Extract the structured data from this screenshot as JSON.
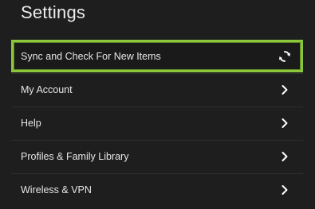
{
  "header": {
    "title": "Settings"
  },
  "menu": {
    "items": [
      {
        "label": "Sync and Check For New Items",
        "trailing_icon": "sync-icon",
        "highlighted": true
      },
      {
        "label": "My Account",
        "trailing_icon": "chevron-right-icon"
      },
      {
        "label": "Help",
        "trailing_icon": "chevron-right-icon"
      },
      {
        "label": "Profiles & Family Library",
        "trailing_icon": "chevron-right-icon"
      },
      {
        "label": "Wireless & VPN",
        "trailing_icon": "chevron-right-icon"
      }
    ]
  },
  "colors": {
    "background": "#1e1e1e",
    "highlight_border": "#8cc63f",
    "text": "#e6e6e6"
  }
}
